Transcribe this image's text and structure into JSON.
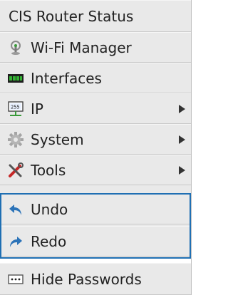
{
  "menu": {
    "title": "CIS Router Status",
    "items": [
      {
        "label": "Wi-Fi Manager",
        "icon": "wifi-manager-icon",
        "submenu": false
      },
      {
        "label": "Interfaces",
        "icon": "interfaces-icon",
        "submenu": false
      },
      {
        "label": "IP",
        "icon": "ip-icon",
        "submenu": true
      },
      {
        "label": "System",
        "icon": "system-gear-icon",
        "submenu": true
      },
      {
        "label": "Tools",
        "icon": "tools-icon",
        "submenu": true
      }
    ],
    "history": [
      {
        "label": "Undo",
        "icon": "undo-icon"
      },
      {
        "label": "Redo",
        "icon": "redo-icon"
      }
    ],
    "hide_passwords": {
      "label": "Hide Passwords",
      "icon": "password-dots-icon"
    }
  },
  "colors": {
    "menu_bg": "#e9e9e9",
    "accent_blue": "#1f6fb3",
    "interfaces_green": "#2f8f2f",
    "tools_red": "#c62828"
  }
}
